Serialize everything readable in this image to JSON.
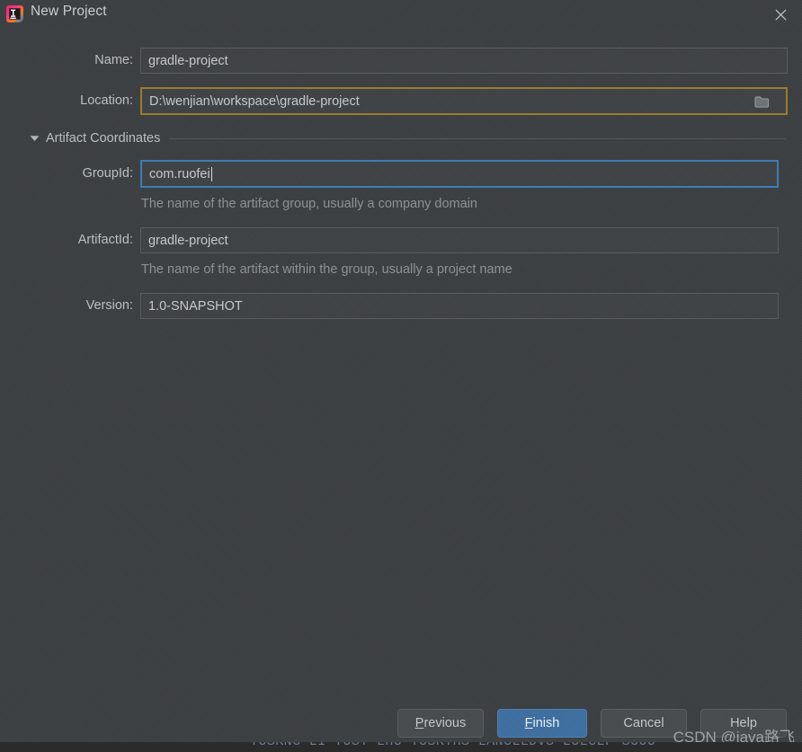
{
  "window": {
    "title": "New Project",
    "logo_icon": "intellij-idea-logo",
    "close_icon": "close-icon"
  },
  "form": {
    "name": {
      "label": "Name:",
      "value": "gradle-project",
      "state": "normal"
    },
    "location": {
      "label": "Location:",
      "value": "D:\\wenjian\\workspace\\gradle-project",
      "state": "warning",
      "browse_icon": "folder-icon"
    }
  },
  "section": {
    "title": "Artifact Coordinates",
    "toggle_icon": "chevron-down-icon",
    "expanded": true,
    "fields": [
      {
        "label": "GroupId:",
        "value": "com.ruofei",
        "state": "focused",
        "hint": "The name of the artifact group, usually a company domain"
      },
      {
        "label": "ArtifactId:",
        "value": "gradle-project",
        "state": "normal",
        "hint": "The name of the artifact within the group, usually a project name"
      },
      {
        "label": "Version:",
        "value": "1.0-SNAPSHOT",
        "state": "normal",
        "hint": ""
      }
    ]
  },
  "buttons": {
    "previous": {
      "label": "Previous",
      "mnemonic": "P",
      "primary": false
    },
    "finish": {
      "label": "Finish",
      "mnemonic": "F",
      "primary": true
    },
    "cancel": {
      "label": "Cancel",
      "mnemonic": "",
      "primary": false
    },
    "help": {
      "label": "Help",
      "mnemonic": "",
      "primary": false
    }
  },
  "overlay": {
    "watermark": "CSDN @java路飞",
    "background_text": "TUSKNG LI TUST LHU TUSKTHS LANCLLDVS LULCLF SUUU"
  },
  "colors": {
    "dialog_background": "#3c3f41",
    "title_bar": "#3c3f41",
    "field_border": "#5a5d5f",
    "warning_border": "#9b7b2d",
    "focus_border": "#3e7bb6",
    "primary_button": "#3c6e9f",
    "text": "#bcbfc1",
    "hint_text": "#8e9194"
  }
}
